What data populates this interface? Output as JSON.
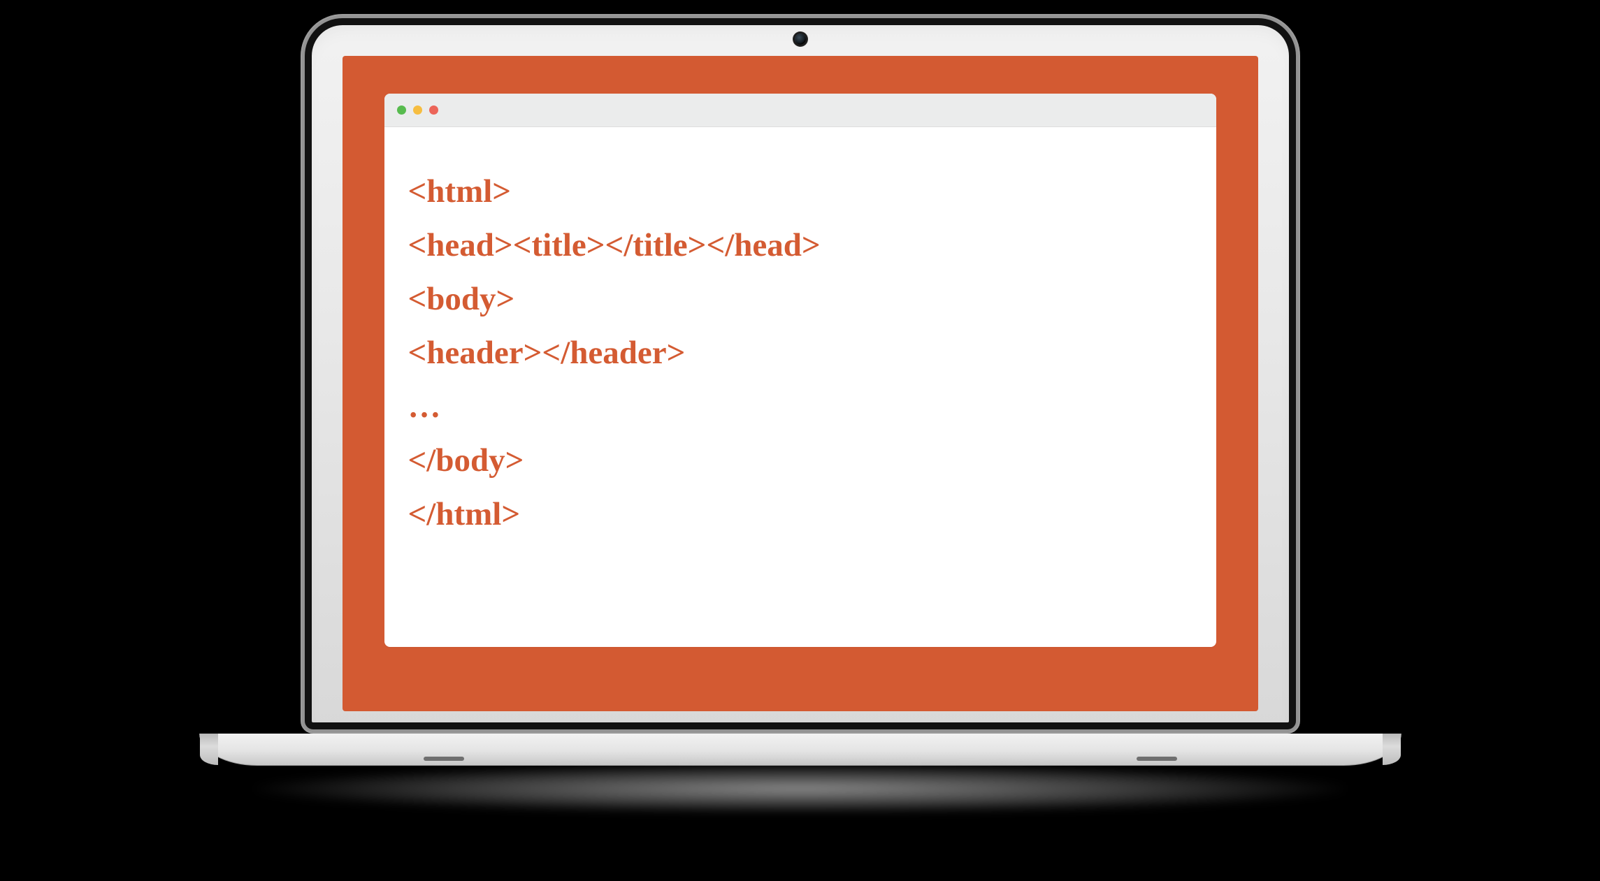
{
  "code": {
    "lines": [
      "<html>",
      "<head><title></title></head>",
      "<body>",
      "<header></header>",
      "…",
      "</body>",
      "</html>"
    ]
  },
  "colors": {
    "screen_background": "#d35a32",
    "code_text": "#d45b32",
    "titlebar": "#ebecec"
  }
}
